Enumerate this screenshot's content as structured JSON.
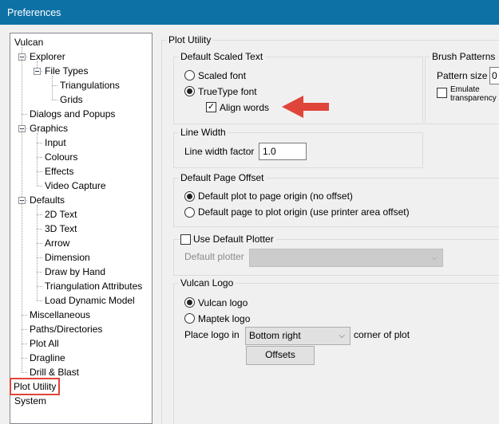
{
  "window": {
    "title": "Preferences"
  },
  "tree": [
    {
      "label": "Vulcan",
      "level": 0,
      "expander": false
    },
    {
      "label": "Explorer",
      "level": 1,
      "expander": true
    },
    {
      "label": "File Types",
      "level": 2,
      "expander": true
    },
    {
      "label": "Triangulations",
      "level": 3,
      "expander": false
    },
    {
      "label": "Grids",
      "level": 3,
      "expander": false
    },
    {
      "label": "Dialogs and Popups",
      "level": 1,
      "expander": false
    },
    {
      "label": "Graphics",
      "level": 1,
      "expander": true
    },
    {
      "label": "Input",
      "level": 2,
      "expander": false
    },
    {
      "label": "Colours",
      "level": 2,
      "expander": false
    },
    {
      "label": "Effects",
      "level": 2,
      "expander": false
    },
    {
      "label": "Video Capture",
      "level": 2,
      "expander": false
    },
    {
      "label": "Defaults",
      "level": 1,
      "expander": true
    },
    {
      "label": "2D Text",
      "level": 2,
      "expander": false
    },
    {
      "label": "3D Text",
      "level": 2,
      "expander": false
    },
    {
      "label": "Arrow",
      "level": 2,
      "expander": false
    },
    {
      "label": "Dimension",
      "level": 2,
      "expander": false
    },
    {
      "label": "Draw by Hand",
      "level": 2,
      "expander": false
    },
    {
      "label": "Triangulation Attributes",
      "level": 2,
      "expander": false
    },
    {
      "label": "Load Dynamic Model",
      "level": 2,
      "expander": false
    },
    {
      "label": "Miscellaneous",
      "level": 1,
      "expander": false
    },
    {
      "label": "Paths/Directories",
      "level": 1,
      "expander": false
    },
    {
      "label": "Plot All",
      "level": 1,
      "expander": false
    },
    {
      "label": "Dragline",
      "level": 1,
      "expander": false
    },
    {
      "label": "Drill & Blast",
      "level": 1,
      "expander": false
    },
    {
      "label": "Plot Utility",
      "level": 0,
      "expander": false,
      "selected": true
    },
    {
      "label": "System",
      "level": 0,
      "expander": false
    }
  ],
  "panel": {
    "title": "Plot Utility",
    "scaled_text": {
      "title": "Default Scaled Text",
      "scaled_font": "Scaled font",
      "truetype_font": "TrueType font",
      "align_words": "Align words",
      "selected": "truetype",
      "align_words_checked": true
    },
    "brush": {
      "title": "Brush Patterns",
      "pattern_size_label": "Pattern size",
      "pattern_size_value": "0",
      "emulate_label": "Emulate transparency",
      "emulate_checked": false
    },
    "line_width": {
      "title": "Line Width",
      "factor_label": "Line width factor",
      "factor_value": "1.0"
    },
    "page_offset": {
      "title": "Default Page Offset",
      "option1": "Default plot to page origin (no offset)",
      "option2": "Default page to plot origin (use printer area offset)",
      "selected": 1
    },
    "plotter": {
      "title": "Use Default Plotter",
      "checked": false,
      "default_label": "Default plotter",
      "default_value": ""
    },
    "logo": {
      "title": "Vulcan Logo",
      "vulcan": "Vulcan logo",
      "maptek": "Maptek logo",
      "selected": "vulcan",
      "place_label": "Place logo in",
      "place_value": "Bottom right",
      "corner_label": "corner of plot",
      "offsets_button": "Offsets"
    }
  },
  "colors": {
    "titlebar": "#0e71a6",
    "annotation": "#e0453a"
  }
}
